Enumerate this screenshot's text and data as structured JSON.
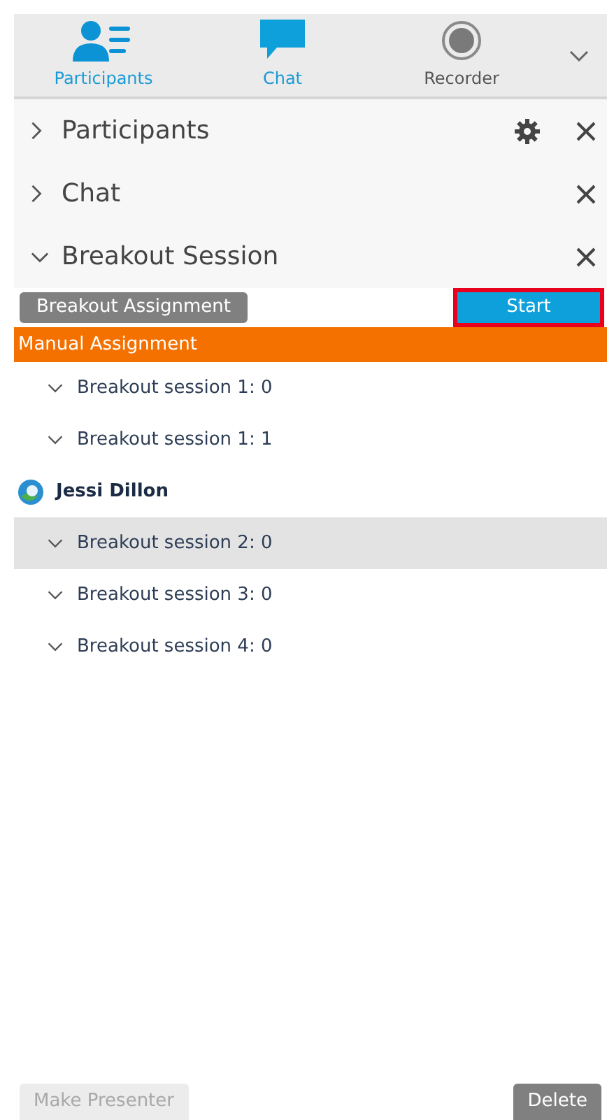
{
  "toolbar": [
    {
      "kind": "participants",
      "label": "Participants",
      "active": true
    },
    {
      "kind": "chat",
      "label": "Chat",
      "active": true
    },
    {
      "kind": "recorder",
      "label": "Recorder",
      "active": false
    }
  ],
  "sections": [
    {
      "title": "Participants",
      "expanded": false,
      "settings": true
    },
    {
      "title": "Chat",
      "expanded": false,
      "settings": false
    },
    {
      "title": "Breakout Session",
      "expanded": true,
      "settings": false
    }
  ],
  "breakout": {
    "assignment_button": "Breakout Assignment",
    "start_button": {
      "label": "Start",
      "highlighted": true
    },
    "mode": "Manual Assignment",
    "items": [
      {
        "kind": "session",
        "label": "Breakout session 1: 0",
        "expanded": true,
        "selected": false
      },
      {
        "kind": "session",
        "label": "Breakout session 1: 1",
        "expanded": true,
        "selected": false
      },
      {
        "kind": "participant",
        "label": "Jessi Dillon",
        "selected": false
      },
      {
        "kind": "session",
        "label": "Breakout session 2: 0",
        "expanded": true,
        "selected": true
      },
      {
        "kind": "session",
        "label": "Breakout session 3: 0",
        "expanded": true,
        "selected": false
      },
      {
        "kind": "session",
        "label": "Breakout session 4: 0",
        "expanded": true,
        "selected": false
      }
    ]
  },
  "footer": [
    {
      "label": "Make Presenter",
      "disabled": true
    },
    {
      "label": "Delete",
      "disabled": false
    }
  ]
}
